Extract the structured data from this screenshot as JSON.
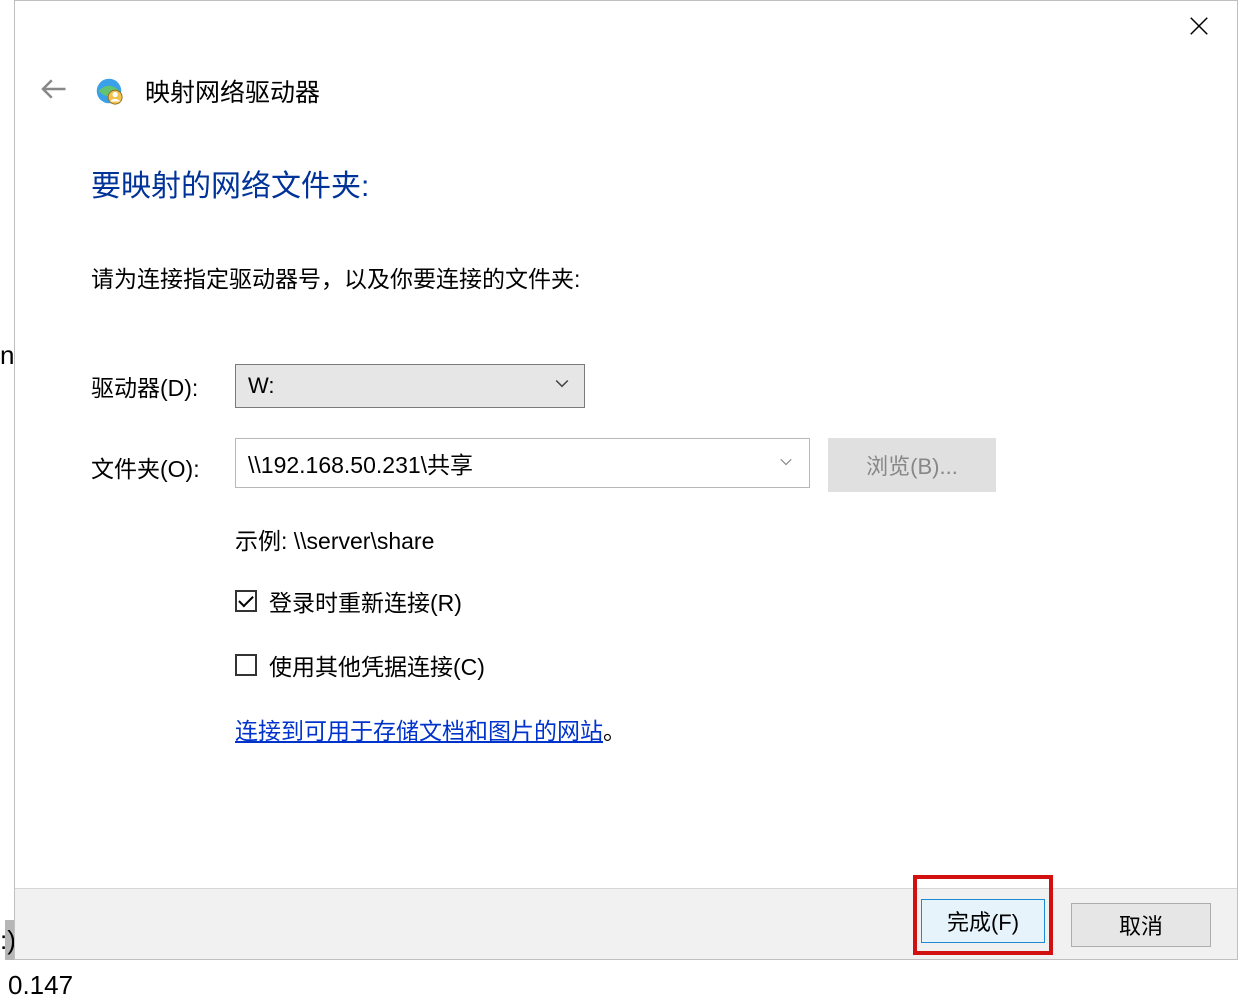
{
  "behind": {
    "left_fragment": "np",
    "colon": ":)",
    "num": "0.147"
  },
  "dialog": {
    "title": "映射网络驱动器",
    "headline": "要映射的网络文件夹:",
    "instruction": "请为连接指定驱动器号，以及你要连接的文件夹:",
    "drive_label": "驱动器(D):",
    "drive_value": "W:",
    "folder_label": "文件夹(O):",
    "folder_value": "\\\\192.168.50.231\\共享",
    "browse_label": "浏览(B)...",
    "example": "示例: \\\\server\\share",
    "reconnect_label": "登录时重新连接(R)",
    "reconnect_checked": true,
    "othercred_label": "使用其他凭据连接(C)",
    "othercred_checked": false,
    "link_text": "连接到可用于存储文档和图片的网站",
    "link_period": "。",
    "finish_label": "完成(F)",
    "cancel_label": "取消"
  }
}
